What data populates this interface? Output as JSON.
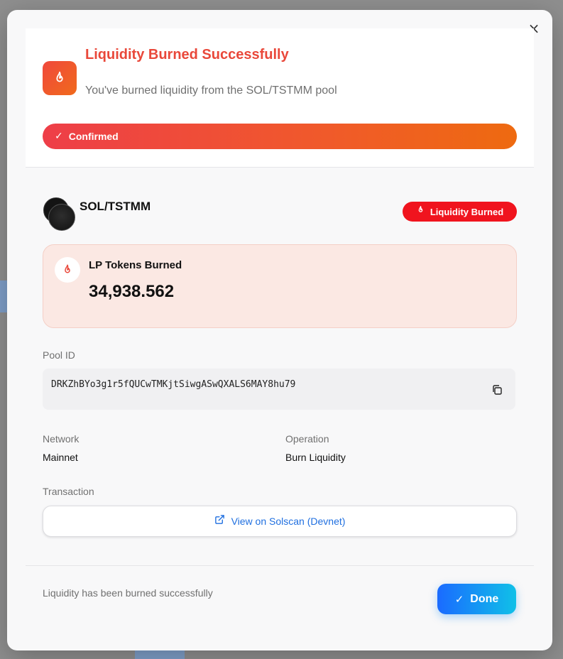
{
  "modal": {
    "close_glyph": "×",
    "title": "Liquidity Burned Successfully",
    "subtitle": "You've burned liquidity from the SOL/TSTMM pool",
    "status_label": "Confirmed",
    "pair": "SOL/TSTMM",
    "badge_label": "Liquidity Burned",
    "lp_label": "LP Tokens Burned",
    "lp_value": "34,938.562",
    "pool_id_label": "Pool ID",
    "pool_id": "DRKZhBYo3g1r5fQUCwTMKjtSiwgASwQXALS6MAY8hu79",
    "network_label": "Network",
    "network_value": "Mainnet",
    "operation_label": "Operation",
    "operation_value": "Burn Liquidity",
    "transaction_label": "Transaction",
    "solscan_label": "View on Solscan (Devnet)",
    "footer_text": "Liquidity has been burned successfully",
    "done_label": "Done"
  },
  "icons": {
    "header": "fire-icon",
    "status": "check-icon",
    "badge": "fire-icon",
    "lp": "fire-icon",
    "copy": "copy-icon",
    "external": "external-link-icon",
    "done": "check-icon"
  },
  "colors": {
    "accent_red": "#e9483a",
    "badge_red": "#f0141e",
    "link_blue": "#1f6fe0",
    "done_gradient_start": "#1a6bff",
    "done_gradient_end": "#10c0e8"
  }
}
